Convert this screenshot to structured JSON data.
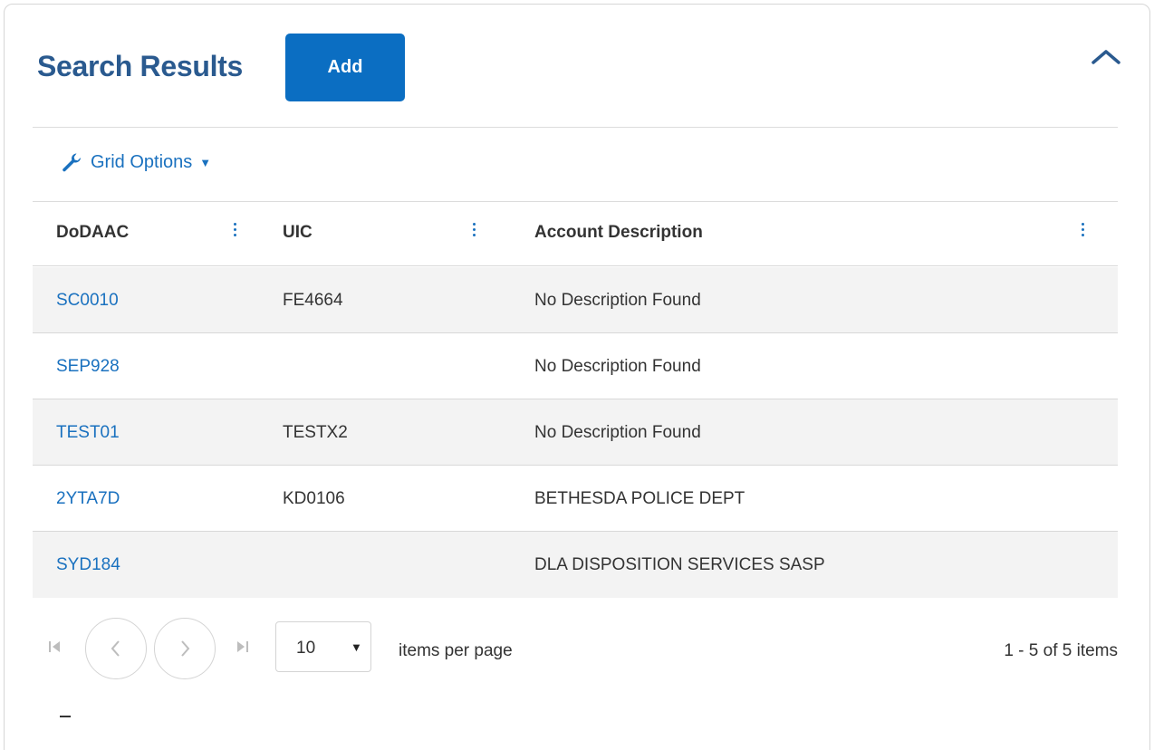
{
  "panel": {
    "title": "Search Results",
    "add_label": "Add",
    "collapse_icon": "chevron-up-icon"
  },
  "toolbar": {
    "grid_options_label": "Grid Options",
    "grid_options_icon": "wrench-icon"
  },
  "table": {
    "columns": [
      "DoDAAC",
      "UIC",
      "Account Description"
    ],
    "rows": [
      {
        "dodaac": "SC0010",
        "uic": "FE4664",
        "description": "No Description Found"
      },
      {
        "dodaac": "SEP928",
        "uic": "",
        "description": "No Description Found"
      },
      {
        "dodaac": "TEST01",
        "uic": "TESTX2",
        "description": "No Description Found"
      },
      {
        "dodaac": "2YTA7D",
        "uic": "KD0106",
        "description": "BETHESDA POLICE DEPT"
      },
      {
        "dodaac": "SYD184",
        "uic": "",
        "description": "DLA DISPOSITION SERVICES SASP"
      }
    ]
  },
  "pager": {
    "page_size": "10",
    "items_per_page_label": "items per page",
    "range_label": "1 - 5 of 5 items"
  },
  "colors": {
    "title": "#2a5a8f",
    "accent": "#0b6ec2",
    "link": "#1a71bf",
    "row_alt": "#f3f3f3"
  }
}
